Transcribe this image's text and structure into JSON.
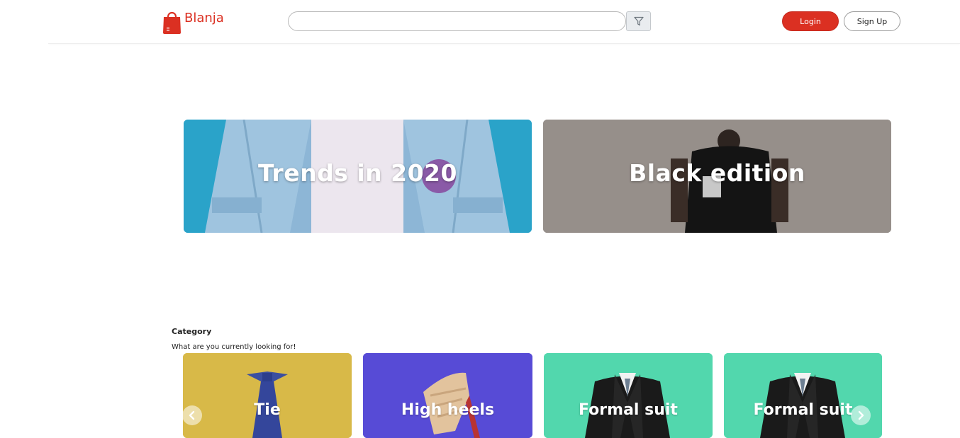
{
  "header": {
    "brand": "Blanja",
    "search": {
      "value": "",
      "placeholder": ""
    },
    "login_label": "Login",
    "signup_label": "Sign Up"
  },
  "banners": [
    {
      "title": "Trends in 2020",
      "color": "#2aa3c9"
    },
    {
      "title": "Black edition",
      "color": "#8d8782"
    }
  ],
  "category": {
    "title": "Category",
    "subtitle": "What are you currently looking for!",
    "items": [
      {
        "label": "Tie",
        "color": "#d8b948",
        "icon": "tie-icon"
      },
      {
        "label": "High heels",
        "color": "#574bd6",
        "icon": "high-heels-icon"
      },
      {
        "label": "Formal suit",
        "color": "#52d7ad",
        "icon": "suit-icon"
      },
      {
        "label": "Formal suit",
        "color": "#52d7ad",
        "icon": "suit-icon"
      }
    ],
    "prev_icon": "chevron-left-icon",
    "next_icon": "chevron-right-icon"
  },
  "colors": {
    "brand": "#DB3022",
    "login_bg": "#DB3022"
  }
}
